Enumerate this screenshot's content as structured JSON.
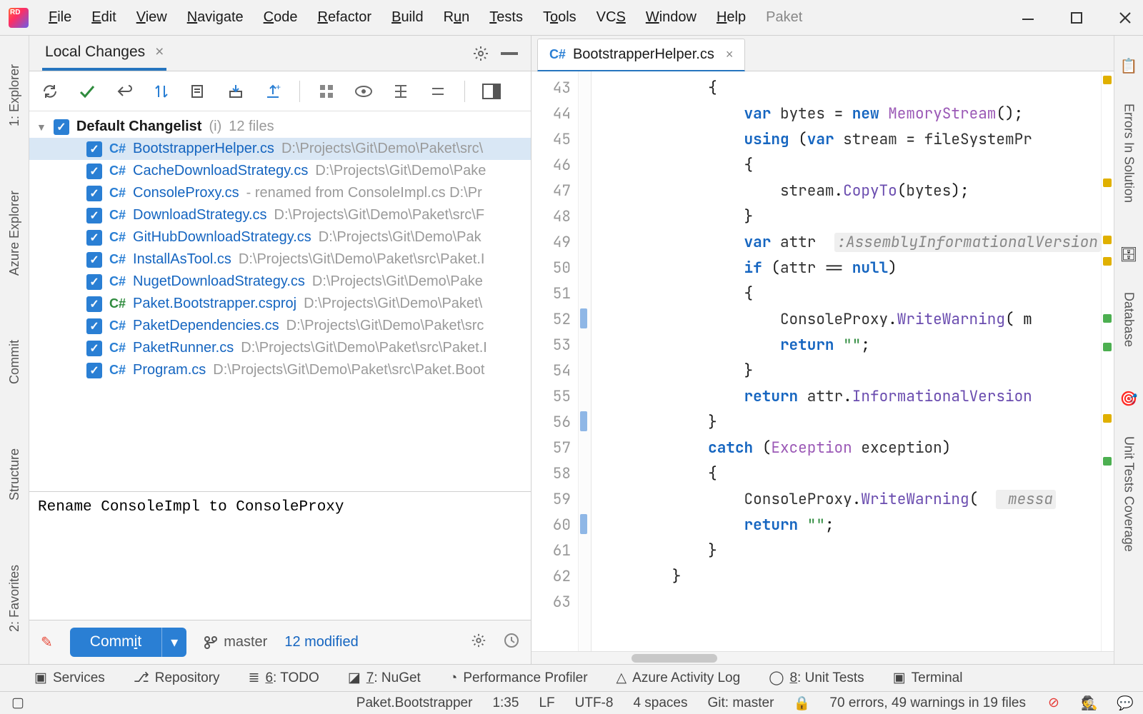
{
  "menu": {
    "items": [
      "File",
      "Edit",
      "View",
      "Navigate",
      "Code",
      "Refactor",
      "Build",
      "Run",
      "Tests",
      "Tools",
      "VCS",
      "Window",
      "Help"
    ],
    "extra": "Paket"
  },
  "left_tw": [
    "1: Explorer",
    "Azure Explorer",
    "Commit",
    "Structure",
    "2: Favorites"
  ],
  "right_tw": [
    "Errors In Solution",
    "Database",
    "Unit Tests Coverage"
  ],
  "changes": {
    "tab": "Local Changes",
    "changelist_name": "Default Changelist",
    "changelist_meta": "(i)",
    "changelist_count": "12 files",
    "files": [
      {
        "icon": "blue",
        "name": "BootstrapperHelper.cs",
        "path": "D:\\Projects\\Git\\Demo\\Paket\\src\\",
        "sel": true
      },
      {
        "icon": "blue",
        "name": "CacheDownloadStrategy.cs",
        "path": "D:\\Projects\\Git\\Demo\\Pake"
      },
      {
        "icon": "blue",
        "name": "ConsoleProxy.cs",
        "path": " - renamed from ConsoleImpl.cs  D:\\Pr"
      },
      {
        "icon": "blue",
        "name": "DownloadStrategy.cs",
        "path": "D:\\Projects\\Git\\Demo\\Paket\\src\\F"
      },
      {
        "icon": "blue",
        "name": "GitHubDownloadStrategy.cs",
        "path": "D:\\Projects\\Git\\Demo\\Pak"
      },
      {
        "icon": "blue",
        "name": "InstallAsTool.cs",
        "path": "D:\\Projects\\Git\\Demo\\Paket\\src\\Paket.I"
      },
      {
        "icon": "blue",
        "name": "NugetDownloadStrategy.cs",
        "path": "D:\\Projects\\Git\\Demo\\Pake"
      },
      {
        "icon": "green",
        "name": "Paket.Bootstrapper.csproj",
        "path": "D:\\Projects\\Git\\Demo\\Paket\\"
      },
      {
        "icon": "blue",
        "name": "PaketDependencies.cs",
        "path": "D:\\Projects\\Git\\Demo\\Paket\\src"
      },
      {
        "icon": "blue",
        "name": "PaketRunner.cs",
        "path": "D:\\Projects\\Git\\Demo\\Paket\\src\\Paket.I"
      },
      {
        "icon": "blue",
        "name": "Program.cs",
        "path": "D:\\Projects\\Git\\Demo\\Paket\\src\\Paket.Boot"
      }
    ],
    "commit_msg": "Rename ConsoleImpl to ConsoleProxy",
    "commit_btn": "Commit",
    "branch": "master",
    "modified": "12 modified"
  },
  "editor": {
    "tab_file": "BootstrapperHelper.cs",
    "first_line_no": 43,
    "lines": [
      "            {",
      "                var bytes = new MemoryStream();",
      "                using (var stream = fileSystemPr",
      "                {",
      "                    stream.CopyTo(bytes);",
      "                }",
      "                var attr  :AssemblyInformationalVersion",
      "                if (attr == null)",
      "                {",
      "                    ConsoleProxy.WriteWarning( m",
      "                    return \"\";",
      "                }",
      "",
      "                return attr.InformationalVersion",
      "            }",
      "            catch (Exception exception)",
      "            {",
      "                ConsoleProxy.WriteWarning(  messa",
      "                return \"\";",
      "            }",
      "        }"
    ]
  },
  "bottom_tw": [
    {
      "icon": "services",
      "label": "Services",
      "u": ""
    },
    {
      "icon": "repo",
      "label": "Repository",
      "u": ""
    },
    {
      "icon": "todo",
      "label": "6: TODO",
      "u": "6"
    },
    {
      "icon": "nuget",
      "label": "7: NuGet",
      "u": "7"
    },
    {
      "icon": "profiler",
      "label": "Performance Profiler",
      "u": ""
    },
    {
      "icon": "azure",
      "label": "Azure Activity Log",
      "u": ""
    },
    {
      "icon": "tests",
      "label": "8: Unit Tests",
      "u": "8"
    },
    {
      "icon": "terminal",
      "label": "Terminal",
      "u": ""
    }
  ],
  "status": {
    "project": "Paket.Bootstrapper",
    "pos": "1:35",
    "le": "LF",
    "enc": "UTF-8",
    "indent": "4 spaces",
    "git": "Git: master",
    "analysis": "70 errors, 49 warnings in 19 files"
  }
}
